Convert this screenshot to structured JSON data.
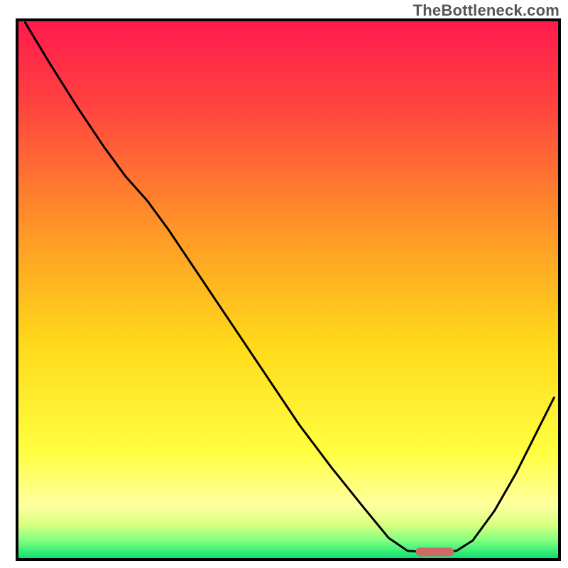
{
  "watermark": "TheBottleneck.com",
  "chart_data": {
    "type": "line",
    "title": "",
    "xlabel": "",
    "ylabel": "",
    "xlim": [
      0,
      100
    ],
    "ylim": [
      0,
      100
    ],
    "grid": false,
    "legend": false,
    "background_gradient": {
      "stops": [
        {
          "offset": 0.0,
          "color": "#ff1a4d"
        },
        {
          "offset": 0.15,
          "color": "#ff4040"
        },
        {
          "offset": 0.4,
          "color": "#ff9a26"
        },
        {
          "offset": 0.6,
          "color": "#ffd91a"
        },
        {
          "offset": 0.8,
          "color": "#ffff40"
        },
        {
          "offset": 0.9,
          "color": "#ffffa0"
        },
        {
          "offset": 0.935,
          "color": "#d8ff80"
        },
        {
          "offset": 0.965,
          "color": "#80ff80"
        },
        {
          "offset": 1.0,
          "color": "#00e070"
        }
      ]
    },
    "series": [
      {
        "name": "bottleneck-curve",
        "stroke": "#000000",
        "stroke_width": 3,
        "points": [
          {
            "x": 1.5,
            "y": 99.5
          },
          {
            "x": 6.0,
            "y": 92.0
          },
          {
            "x": 11.0,
            "y": 84.0
          },
          {
            "x": 16.0,
            "y": 76.5
          },
          {
            "x": 20.0,
            "y": 71.0
          },
          {
            "x": 24.0,
            "y": 66.5
          },
          {
            "x": 28.0,
            "y": 61.0
          },
          {
            "x": 34.0,
            "y": 52.0
          },
          {
            "x": 40.0,
            "y": 43.0
          },
          {
            "x": 46.0,
            "y": 34.0
          },
          {
            "x": 52.0,
            "y": 25.0
          },
          {
            "x": 58.0,
            "y": 17.0
          },
          {
            "x": 64.0,
            "y": 9.5
          },
          {
            "x": 68.5,
            "y": 4.0
          },
          {
            "x": 72.0,
            "y": 1.6
          },
          {
            "x": 75.0,
            "y": 1.4
          },
          {
            "x": 78.0,
            "y": 1.4
          },
          {
            "x": 81.0,
            "y": 1.6
          },
          {
            "x": 84.0,
            "y": 3.5
          },
          {
            "x": 88.0,
            "y": 9.0
          },
          {
            "x": 92.0,
            "y": 16.0
          },
          {
            "x": 96.0,
            "y": 24.0
          },
          {
            "x": 99.0,
            "y": 30.0
          }
        ]
      }
    ],
    "markers": [
      {
        "name": "optimal-range-marker",
        "shape": "rounded-rect",
        "x0": 73.5,
        "x1": 80.5,
        "y": 1.4,
        "height_frac": 0.016,
        "fill": "#d06868"
      }
    ],
    "border": {
      "color": "#000000",
      "width": 4
    }
  }
}
